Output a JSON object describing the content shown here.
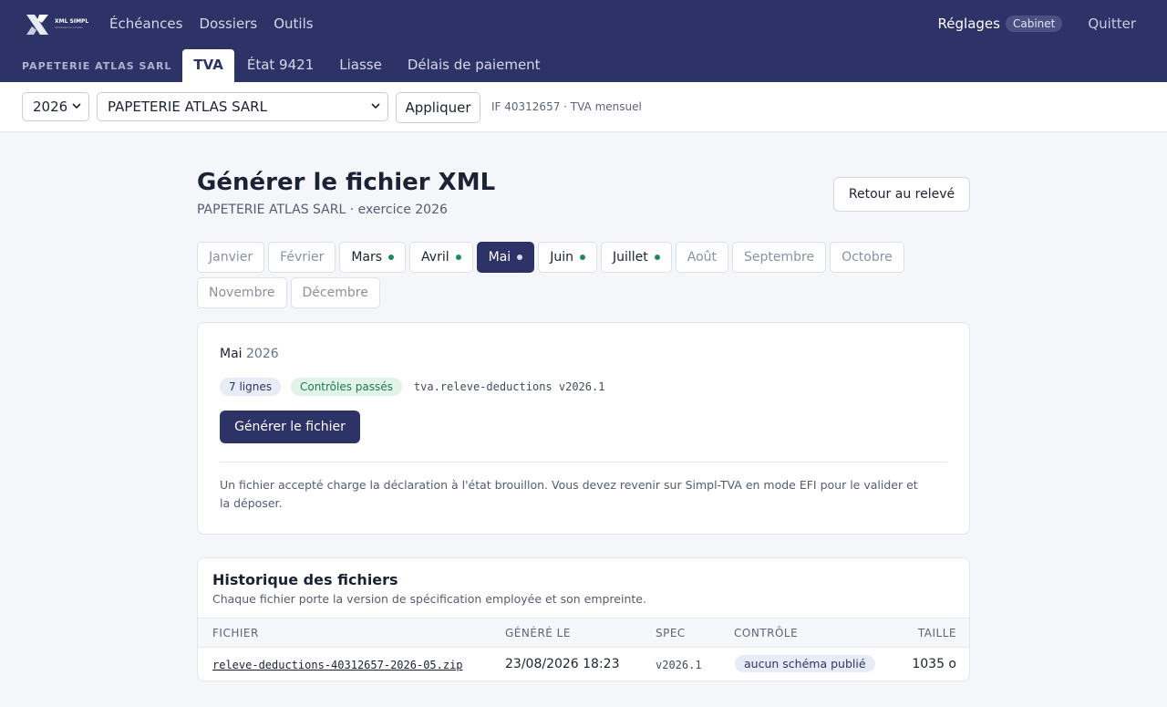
{
  "brand": {
    "logo_text": "XML SIMPL",
    "logo_subtext": "déclarations simples"
  },
  "nav": {
    "items": [
      "Échéances",
      "Dossiers",
      "Outils"
    ],
    "settings_label": "Réglages",
    "settings_badge": "Cabinet",
    "quit_label": "Quitter"
  },
  "subnav": {
    "company": "PAPETERIE ATLAS SARL",
    "tabs": [
      {
        "label": "TVA",
        "active": true
      },
      {
        "label": "État 9421",
        "active": false
      },
      {
        "label": "Liasse",
        "active": false
      },
      {
        "label": "Délais de paiement",
        "active": false
      }
    ]
  },
  "filters": {
    "year": "2026",
    "company": "PAPETERIE ATLAS SARL",
    "apply_label": "Appliquer",
    "info": "IF 40312657 · TVA mensuel"
  },
  "page": {
    "title": "Générer le fichier XML",
    "subtitle": "PAPETERIE ATLAS SARL · exercice 2026",
    "back_label": "Retour au relevé"
  },
  "months": [
    {
      "label": "Janvier",
      "has_data": false,
      "active": false
    },
    {
      "label": "Février",
      "has_data": false,
      "active": false
    },
    {
      "label": "Mars",
      "has_data": true,
      "active": false
    },
    {
      "label": "Avril",
      "has_data": true,
      "active": false
    },
    {
      "label": "Mai",
      "has_data": true,
      "active": true
    },
    {
      "label": "Juin",
      "has_data": true,
      "active": false
    },
    {
      "label": "Juillet",
      "has_data": true,
      "active": false
    },
    {
      "label": "Août",
      "has_data": false,
      "active": false
    },
    {
      "label": "Septembre",
      "has_data": false,
      "active": false
    },
    {
      "label": "Octobre",
      "has_data": false,
      "active": false
    },
    {
      "label": "Novembre",
      "has_data": false,
      "active": false
    },
    {
      "label": "Décembre",
      "has_data": false,
      "active": false
    }
  ],
  "card": {
    "period_month": "Mai",
    "period_year": "2026",
    "lines_chip": "7 lignes",
    "status_chip": "Contrôles passés",
    "spec": "tva.releve-deductions v2026.1",
    "generate_label": "Générer le fichier",
    "note": "Un fichier accepté charge la déclaration à l'état brouillon. Vous devez revenir sur Simpl-TVA en mode EFI pour le valider et la déposer."
  },
  "history": {
    "title": "Historique des fichiers",
    "subtitle": "Chaque fichier porte la version de spécification employée et son empreinte.",
    "columns": {
      "file": "FICHIER",
      "generated": "GÉNÉRÉ LE",
      "spec": "SPEC",
      "control": "CONTRÔLE",
      "size": "TAILLE"
    },
    "rows": [
      {
        "file": "releve-deductions-40312657-2026-05.zip",
        "generated": "23/08/2026 18:23",
        "spec": "v2026.1",
        "control": "aucun schéma publié",
        "size": "1035 o"
      }
    ]
  },
  "colors": {
    "primary": "#2d3366",
    "success": "#1f8a5c",
    "background": "#f4f6fa"
  }
}
